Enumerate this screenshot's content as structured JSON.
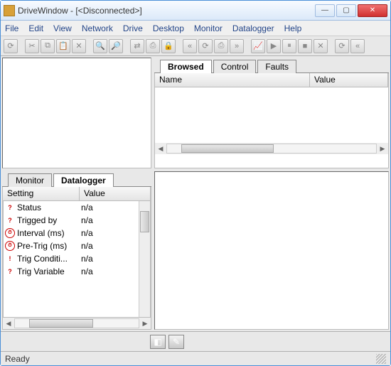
{
  "title": "DriveWindow - [<Disconnected>]",
  "menu": [
    "File",
    "Edit",
    "View",
    "Network",
    "Drive",
    "Desktop",
    "Monitor",
    "Datalogger",
    "Help"
  ],
  "toolbar_icons": [
    "⟳",
    "sep",
    "✂",
    "⧉",
    "📋",
    "✕",
    "sep",
    "🔍",
    "🔎",
    "sep",
    "⇄",
    "⎙",
    "🔒",
    "sep",
    "«",
    "⟳",
    "⎙",
    "»",
    "sep",
    "📈",
    "▶",
    "⏸",
    "■",
    "✕",
    "sep",
    "⟳",
    "«"
  ],
  "right_tabs": [
    "Browsed",
    "Control",
    "Faults"
  ],
  "right_tabs_active": 0,
  "right_cols": {
    "name": "Name",
    "value": "Value"
  },
  "left_tabs": [
    "Monitor",
    "Datalogger"
  ],
  "left_tabs_active": 1,
  "left_cols": {
    "setting": "Setting",
    "value": "Value"
  },
  "settings": [
    {
      "icon": "q",
      "name": "Status",
      "value": "n/a"
    },
    {
      "icon": "q",
      "name": "Trigged by",
      "value": "n/a"
    },
    {
      "icon": "clk",
      "name": "Interval (ms)",
      "value": "n/a"
    },
    {
      "icon": "clk",
      "name": "Pre-Trig (ms)",
      "value": "n/a"
    },
    {
      "icon": "ex",
      "name": "Trig Conditi...",
      "value": "n/a"
    },
    {
      "icon": "q",
      "name": "Trig Variable",
      "value": "n/a"
    }
  ],
  "bottom_icons": [
    "◧",
    "✎"
  ],
  "status": "Ready",
  "winbtns": {
    "min": "—",
    "max": "▢",
    "close": "✕"
  }
}
